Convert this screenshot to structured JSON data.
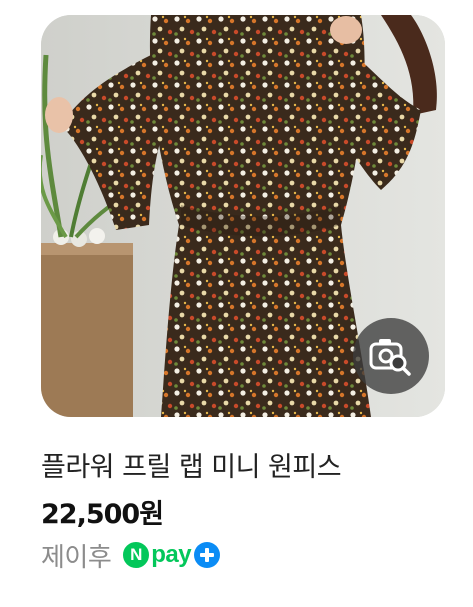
{
  "product": {
    "title": "플라워 프릴 랩 미니 원피스",
    "price": "22,500",
    "price_unit": "원",
    "seller": "제이후",
    "image_alt": "product photo: floral print wrap mini dress",
    "image_search_icon": "camera-search-icon",
    "badge": {
      "icon": "npay-plus-icon",
      "n_letter": "N",
      "pay_text": "pay"
    }
  },
  "colors": {
    "npay_green": "#03c75a",
    "npay_plus_blue": "#0b8cf5",
    "title_text": "#222222",
    "seller_text": "#8c8c8c"
  }
}
